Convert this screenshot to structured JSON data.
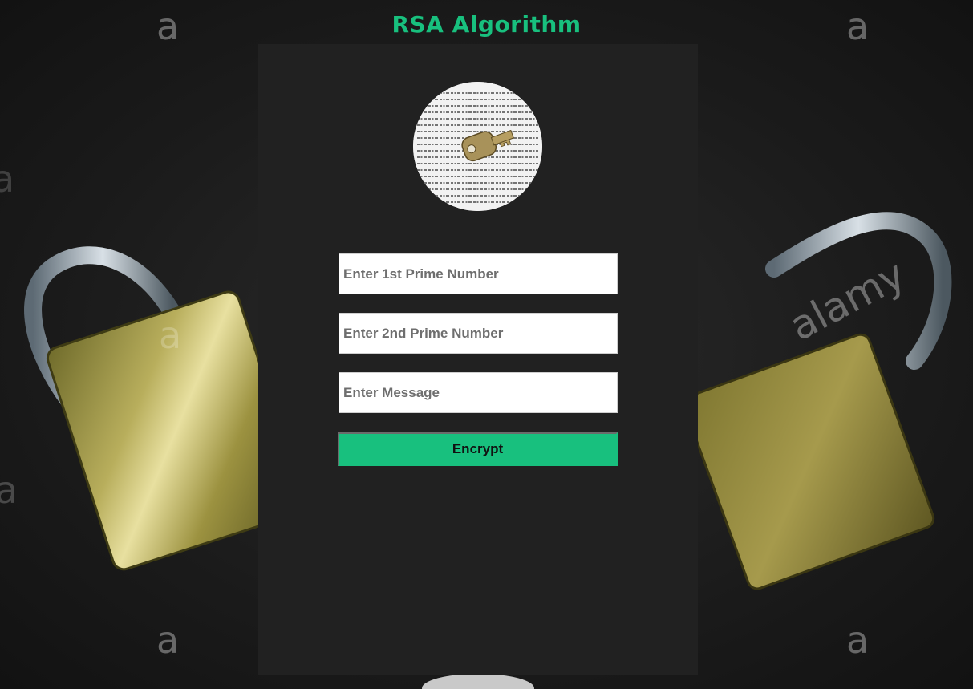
{
  "page": {
    "title": "RSA Algorithm",
    "accent_color": "#18c07e",
    "panel_color": "#212121"
  },
  "background": {
    "image": "padlock-photo",
    "watermark_letter": "a",
    "watermark_word": "alamy"
  },
  "form": {
    "avatar_image": "key-on-cipher-text",
    "first_prime": {
      "placeholder": "Enter 1st Prime Number",
      "value": ""
    },
    "second_prime": {
      "placeholder": "Enter 2nd Prime Number",
      "value": ""
    },
    "message": {
      "placeholder": "Enter Message",
      "value": ""
    },
    "encrypt_label": "Encrypt"
  }
}
